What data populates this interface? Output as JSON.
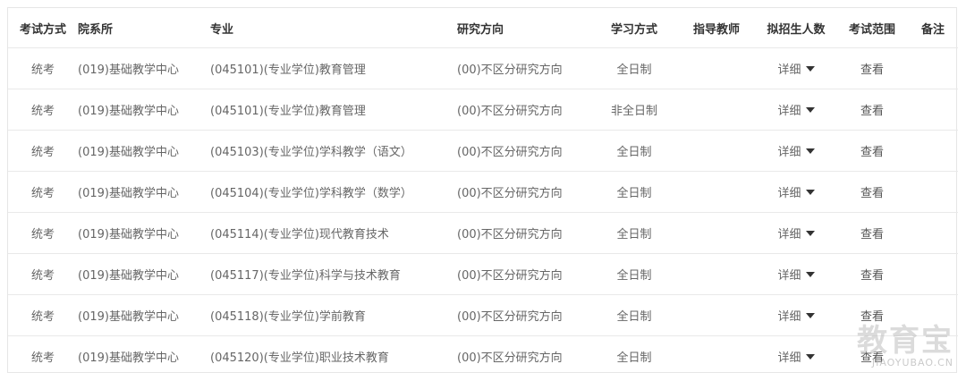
{
  "table": {
    "headers": [
      "考试方式",
      "院系所",
      "专业",
      "研究方向",
      "学习方式",
      "指导教师",
      "拟招生人数",
      "考试范围",
      "备注"
    ],
    "rows": [
      {
        "exam": "统考",
        "dept": "(019)基础教学中心",
        "major": "(045101)(专业学位)教育管理",
        "direction": "(00)不区分研究方向",
        "mode": "全日制",
        "advisor": "",
        "quota": "详细",
        "scope": "查看",
        "note": ""
      },
      {
        "exam": "统考",
        "dept": "(019)基础教学中心",
        "major": "(045101)(专业学位)教育管理",
        "direction": "(00)不区分研究方向",
        "mode": "非全日制",
        "advisor": "",
        "quota": "详细",
        "scope": "查看",
        "note": ""
      },
      {
        "exam": "统考",
        "dept": "(019)基础教学中心",
        "major": "(045103)(专业学位)学科教学（语文）",
        "direction": "(00)不区分研究方向",
        "mode": "全日制",
        "advisor": "",
        "quota": "详细",
        "scope": "查看",
        "note": ""
      },
      {
        "exam": "统考",
        "dept": "(019)基础教学中心",
        "major": "(045104)(专业学位)学科教学（数学）",
        "direction": "(00)不区分研究方向",
        "mode": "全日制",
        "advisor": "",
        "quota": "详细",
        "scope": "查看",
        "note": ""
      },
      {
        "exam": "统考",
        "dept": "(019)基础教学中心",
        "major": "(045114)(专业学位)现代教育技术",
        "direction": "(00)不区分研究方向",
        "mode": "全日制",
        "advisor": "",
        "quota": "详细",
        "scope": "查看",
        "note": ""
      },
      {
        "exam": "统考",
        "dept": "(019)基础教学中心",
        "major": "(045117)(专业学位)科学与技术教育",
        "direction": "(00)不区分研究方向",
        "mode": "全日制",
        "advisor": "",
        "quota": "详细",
        "scope": "查看",
        "note": ""
      },
      {
        "exam": "统考",
        "dept": "(019)基础教学中心",
        "major": "(045118)(专业学位)学前教育",
        "direction": "(00)不区分研究方向",
        "mode": "全日制",
        "advisor": "",
        "quota": "详细",
        "scope": "查看",
        "note": ""
      },
      {
        "exam": "统考",
        "dept": "(019)基础教学中心",
        "major": "(045120)(专业学位)职业技术教育",
        "direction": "(00)不区分研究方向",
        "mode": "全日制",
        "advisor": "",
        "quota": "详细",
        "scope": "查看",
        "note": ""
      }
    ]
  },
  "watermark": {
    "main": "教育宝",
    "sub": "JIAOYUBAO.CN"
  }
}
